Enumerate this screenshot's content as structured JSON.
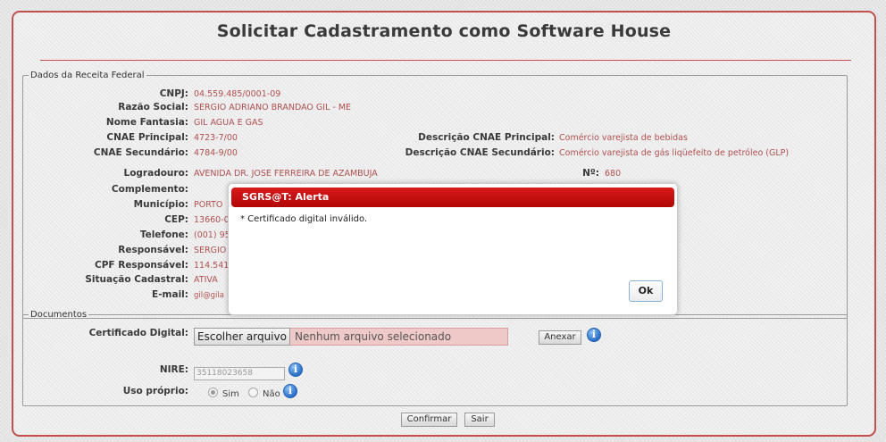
{
  "page": {
    "title": "Solicitar Cadastramento como Software House"
  },
  "receita": {
    "legend": "Dados da Receita Federal",
    "cnpj": {
      "label": "CNPJ:",
      "value": "04.559.485/0001-09"
    },
    "razao": {
      "label": "Razão Social:",
      "value": "SERGIO ADRIANO BRANDAO GIL - ME"
    },
    "fantasia": {
      "label": "Nome Fantasia:",
      "value": "GIL AGUA E GAS"
    },
    "cnae_principal": {
      "label": "CNAE Principal:",
      "value": "4723-7/00"
    },
    "cnae_secundario": {
      "label": "CNAE Secundário:",
      "value": "4784-9/00"
    },
    "desc_cnae_principal": {
      "label": "Descrição CNAE Principal:",
      "value": "Comércio varejista de bebidas"
    },
    "desc_cnae_secundario": {
      "label": "Descrição CNAE Secundário:",
      "value": "Comércio varejista de gás liqüefeito de petróleo (GLP)"
    },
    "logradouro": {
      "label": "Logradouro:",
      "value": "AVENIDA DR. JOSE FERREIRA DE AZAMBUJA"
    },
    "numero": {
      "label": "Nº:",
      "value": "680"
    },
    "complemento": {
      "label": "Complemento:",
      "value": ""
    },
    "municipio": {
      "label": "Município:",
      "value": "PORTO"
    },
    "cep": {
      "label": "CEP:",
      "value": "13660-0"
    },
    "telefone": {
      "label": "Telefone:",
      "value": "(001) 95"
    },
    "responsavel": {
      "label": "Responsável:",
      "value": "SERGIO"
    },
    "cpf_responsavel": {
      "label": "CPF Responsável:",
      "value": "114.541"
    },
    "situacao": {
      "label": "Situação Cadastral:",
      "value": "ATIVA"
    },
    "email": {
      "label": "E-mail:",
      "value": "gil@gila"
    }
  },
  "documentos": {
    "legend": "Documentos",
    "certificado_label": "Certificado Digital:",
    "file_button": "Escolher arquivo",
    "file_status": "Nenhum arquivo selecionado",
    "anexar": "Anexar",
    "nire_label": "NIRE:",
    "nire_value": "35118023658",
    "uso_label": "Uso próprio:",
    "sim": "Sim",
    "nao": "Não",
    "uso_selected": "Sim"
  },
  "footer": {
    "confirmar": "Confirmar",
    "sair": "Sair"
  },
  "alert": {
    "title": "SGRS@T: Alerta",
    "message": "* Certificado digital inválido.",
    "ok": "Ok"
  },
  "icons": {
    "info": "i"
  },
  "colors": {
    "accent": "#c0504d",
    "value_text": "#b05050",
    "alert_header": "#c80f0f"
  }
}
